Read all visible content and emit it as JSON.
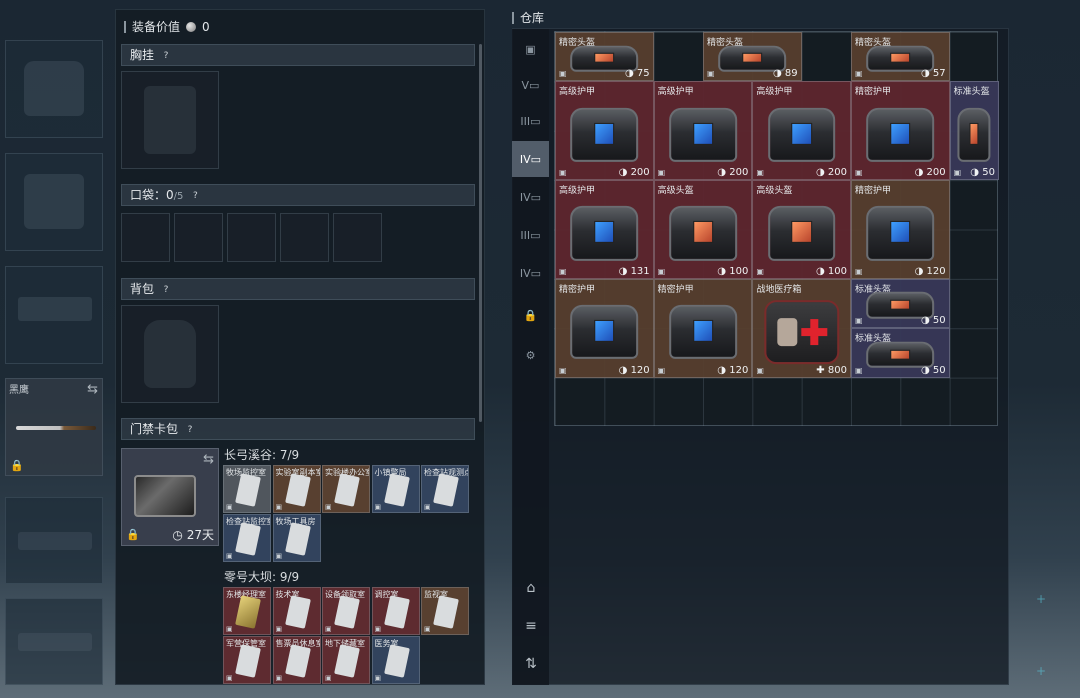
{
  "loadout": {
    "equip_value_label": "装备价值",
    "equip_value": "0",
    "knife_name": "黑鹰",
    "sections": {
      "chest_rig": "胸挂",
      "pockets": "口袋",
      "pockets_count": "0",
      "pockets_max": "/5",
      "backpack": "背包",
      "keycard_case": "门禁卡包"
    },
    "keycase_days": "27天",
    "groups": [
      {
        "title": "长弓溪谷: 7/9",
        "cards": [
          {
            "name": "牧场监控室",
            "color": "gray"
          },
          {
            "name": "实验室副本室",
            "color": "brown"
          },
          {
            "name": "实验楼办公室",
            "color": "brown"
          },
          {
            "name": "小镇警局",
            "color": "blue"
          },
          {
            "name": "检查站观测点",
            "color": "blue"
          },
          {
            "name": "检查站监控室",
            "color": "blue"
          },
          {
            "name": "牧场工具房",
            "color": "blue"
          }
        ]
      },
      {
        "title": "零号大坝: 9/9",
        "cards": [
          {
            "name": "东楼经理室",
            "color": "red"
          },
          {
            "name": "技术室",
            "color": "red"
          },
          {
            "name": "设备领取室",
            "color": "red"
          },
          {
            "name": "调控室",
            "color": "red"
          },
          {
            "name": "监视室",
            "color": "brown"
          },
          {
            "name": "军营保管室",
            "color": "red"
          },
          {
            "name": "售票员休息室",
            "color": "red"
          },
          {
            "name": "地下储藏室",
            "color": "red"
          },
          {
            "name": "医务室",
            "color": "blue"
          }
        ]
      }
    ]
  },
  "warehouse": {
    "title": "仓库",
    "tabs": [
      "all",
      "V",
      "III",
      "IV",
      "IV",
      "III",
      "IV",
      "lock",
      "gear"
    ],
    "items": [
      {
        "name": "精密头盔",
        "durability": "75",
        "rarity": "brown",
        "kind": "helmet"
      },
      {
        "name": "精密头盔",
        "durability": "89",
        "rarity": "brown",
        "kind": "helmet"
      },
      {
        "name": "精密头盔",
        "durability": "57",
        "rarity": "brown",
        "kind": "helmet"
      },
      {
        "name": "高级护甲",
        "durability": "200",
        "rarity": "red",
        "kind": "armor"
      },
      {
        "name": "高级护甲",
        "durability": "200",
        "rarity": "red",
        "kind": "armor"
      },
      {
        "name": "高级护甲",
        "durability": "200",
        "rarity": "red",
        "kind": "armor"
      },
      {
        "name": "精密护甲",
        "durability": "200",
        "rarity": "red",
        "kind": "armor"
      },
      {
        "name": "标准头盔",
        "durability": "50",
        "rarity": "purple",
        "kind": "helmet"
      },
      {
        "name": "高级护甲",
        "durability": "131",
        "rarity": "red",
        "kind": "armor"
      },
      {
        "name": "高级头盔",
        "durability": "100",
        "rarity": "red",
        "kind": "helmet"
      },
      {
        "name": "高级头盔",
        "durability": "100",
        "rarity": "red",
        "kind": "helmet"
      },
      {
        "name": "精密护甲",
        "durability": "120",
        "rarity": "brown",
        "kind": "armor"
      },
      {
        "name": "精密护甲",
        "durability": "120",
        "rarity": "brown",
        "kind": "armor"
      },
      {
        "name": "精密护甲",
        "durability": "120",
        "rarity": "brown",
        "kind": "armor"
      },
      {
        "name": "战地医疗箱",
        "durability": "800",
        "rarity": "brown",
        "kind": "medkit"
      },
      {
        "name": "标准头盔",
        "durability": "50",
        "rarity": "purple",
        "kind": "helmet"
      },
      {
        "name": "标准头盔",
        "durability": "50",
        "rarity": "purple",
        "kind": "helmet"
      }
    ]
  },
  "icons": {
    "coin": "coin-icon",
    "swap": "swap-icon",
    "lock": "lock-icon",
    "clock": "clock-icon",
    "help": "help-icon"
  }
}
